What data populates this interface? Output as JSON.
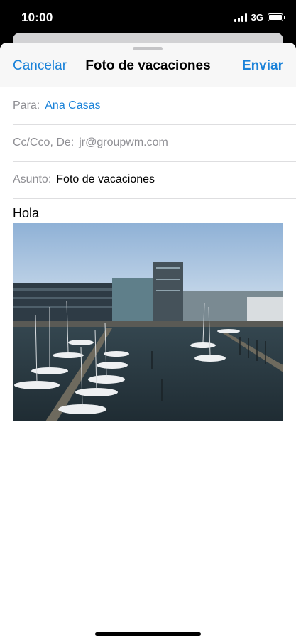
{
  "status": {
    "time": "10:00",
    "network": "3G",
    "signal_bars": 4,
    "battery_level": 1.0
  },
  "compose": {
    "cancel_label": "Cancelar",
    "title": "Foto de vacaciones",
    "send_label": "Enviar",
    "to_label": "Para:",
    "to_value": "Ana Casas",
    "cc_label": "Cc/Cco, De:",
    "cc_value": "jr@groupwm.com",
    "subject_label": "Asunto:",
    "subject_value": "Foto de vacaciones",
    "body_text": "Hola"
  },
  "colors": {
    "accent": "#1a82d9",
    "label_gray": "#8e8e93",
    "water": "#2a3a44",
    "sky": "#8fb1d6"
  },
  "attachment": {
    "icon": "image-attachment"
  }
}
